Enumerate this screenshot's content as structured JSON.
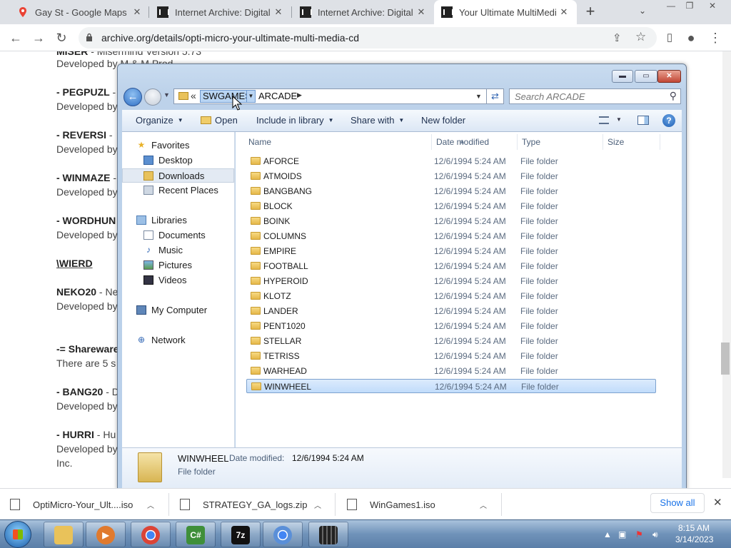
{
  "browser": {
    "tabs": [
      {
        "title": "Gay St - Google Maps",
        "icon": "google-maps-icon"
      },
      {
        "title": "Internet Archive: Digital L",
        "icon": "internet-archive-icon"
      },
      {
        "title": "Internet Archive: Digital L",
        "icon": "internet-archive-icon"
      },
      {
        "title": "Your Ultimate MultiMedi",
        "icon": "internet-archive-icon"
      }
    ],
    "url": "archive.org/details/opti-micro-your-ultimate-multi-media-cd"
  },
  "page": {
    "lines": [
      {
        "bold": "MISER",
        "text": " - Misermind Version 5.73"
      },
      {
        "bold": "",
        "text": "Developed by M & M Prod..."
      },
      {
        "bold": "- PEGPUZL",
        "text": " - "
      },
      {
        "bold": "",
        "text": "Developed by"
      },
      {
        "bold": "- REVERSI",
        "text": " - "
      },
      {
        "bold": "",
        "text": "Developed by"
      },
      {
        "bold": "- WINMAZE",
        "text": " - "
      },
      {
        "bold": "",
        "text": "Developed by"
      },
      {
        "bold": "- WORDHUN",
        "text": ""
      },
      {
        "bold": "",
        "text": "Developed by"
      },
      {
        "bold": "\\WIERD",
        "text": ""
      },
      {
        "bold": "NEKO20",
        "text": " - Ne"
      },
      {
        "bold": "",
        "text": "Developed by"
      },
      {
        "bold": "-= Shareware",
        "text": ""
      },
      {
        "bold": "",
        "text": "There are 5 s"
      },
      {
        "bold": "- BANG20",
        "text": " - D"
      },
      {
        "bold": "",
        "text": "Developed by"
      },
      {
        "bold": "- HURRI",
        "text": " - Hu"
      },
      {
        "bold": "",
        "text": "Developed by"
      },
      {
        "bold": "",
        "text": "Inc."
      }
    ]
  },
  "explorer": {
    "breadcrumb": {
      "more": "«",
      "folder1": "SWGAMES",
      "folder2": "ARCADE"
    },
    "search_placeholder": "Search ARCADE",
    "commands": {
      "organize": "Organize",
      "open": "Open",
      "include": "Include in library",
      "share": "Share with",
      "new_folder": "New folder"
    },
    "nav": {
      "favorites": "Favorites",
      "desktop": "Desktop",
      "downloads": "Downloads",
      "recent": "Recent Places",
      "libraries": "Libraries",
      "documents": "Documents",
      "music": "Music",
      "pictures": "Pictures",
      "videos": "Videos",
      "computer": "My Computer",
      "network": "Network"
    },
    "columns": {
      "name": "Name",
      "date": "Date modified",
      "type": "Type",
      "size": "Size"
    },
    "files": [
      {
        "name": "AFORCE",
        "date": "12/6/1994 5:24 AM",
        "type": "File folder"
      },
      {
        "name": "ATMOIDS",
        "date": "12/6/1994 5:24 AM",
        "type": "File folder"
      },
      {
        "name": "BANGBANG",
        "date": "12/6/1994 5:24 AM",
        "type": "File folder"
      },
      {
        "name": "BLOCK",
        "date": "12/6/1994 5:24 AM",
        "type": "File folder"
      },
      {
        "name": "BOINK",
        "date": "12/6/1994 5:24 AM",
        "type": "File folder"
      },
      {
        "name": "COLUMNS",
        "date": "12/6/1994 5:24 AM",
        "type": "File folder"
      },
      {
        "name": "EMPIRE",
        "date": "12/6/1994 5:24 AM",
        "type": "File folder"
      },
      {
        "name": "FOOTBALL",
        "date": "12/6/1994 5:24 AM",
        "type": "File folder"
      },
      {
        "name": "HYPEROID",
        "date": "12/6/1994 5:24 AM",
        "type": "File folder"
      },
      {
        "name": "KLOTZ",
        "date": "12/6/1994 5:24 AM",
        "type": "File folder"
      },
      {
        "name": "LANDER",
        "date": "12/6/1994 5:24 AM",
        "type": "File folder"
      },
      {
        "name": "PENT1020",
        "date": "12/6/1994 5:24 AM",
        "type": "File folder"
      },
      {
        "name": "STELLAR",
        "date": "12/6/1994 5:24 AM",
        "type": "File folder"
      },
      {
        "name": "TETRISS",
        "date": "12/6/1994 5:24 AM",
        "type": "File folder"
      },
      {
        "name": "WARHEAD",
        "date": "12/6/1994 5:24 AM",
        "type": "File folder"
      },
      {
        "name": "WINWHEEL",
        "date": "12/6/1994 5:24 AM",
        "type": "File folder",
        "selected": true
      }
    ],
    "details": {
      "name": "WINWHEEL",
      "modified_label": "Date modified:",
      "modified_value": "12/6/1994 5:24 AM",
      "type": "File folder"
    }
  },
  "downloads": {
    "items": [
      "OptiMicro-Your_Ult....iso",
      "STRATEGY_GA_logs.zip",
      "WinGames1.iso"
    ],
    "show_all": "Show all"
  },
  "taskbar": {
    "apps": [
      {
        "icon": "file-explorer-icon",
        "label": ""
      },
      {
        "icon": "media-player-icon",
        "label": ""
      },
      {
        "icon": "chrome-icon",
        "label": ""
      },
      {
        "icon": "csharp-icon",
        "label": "C#"
      },
      {
        "icon": "7zip-icon",
        "label": "7z"
      },
      {
        "icon": "chrome-icon",
        "label": ""
      },
      {
        "icon": "film-icon",
        "label": ""
      }
    ],
    "time": "8:15 AM",
    "date": "3/14/2023"
  }
}
